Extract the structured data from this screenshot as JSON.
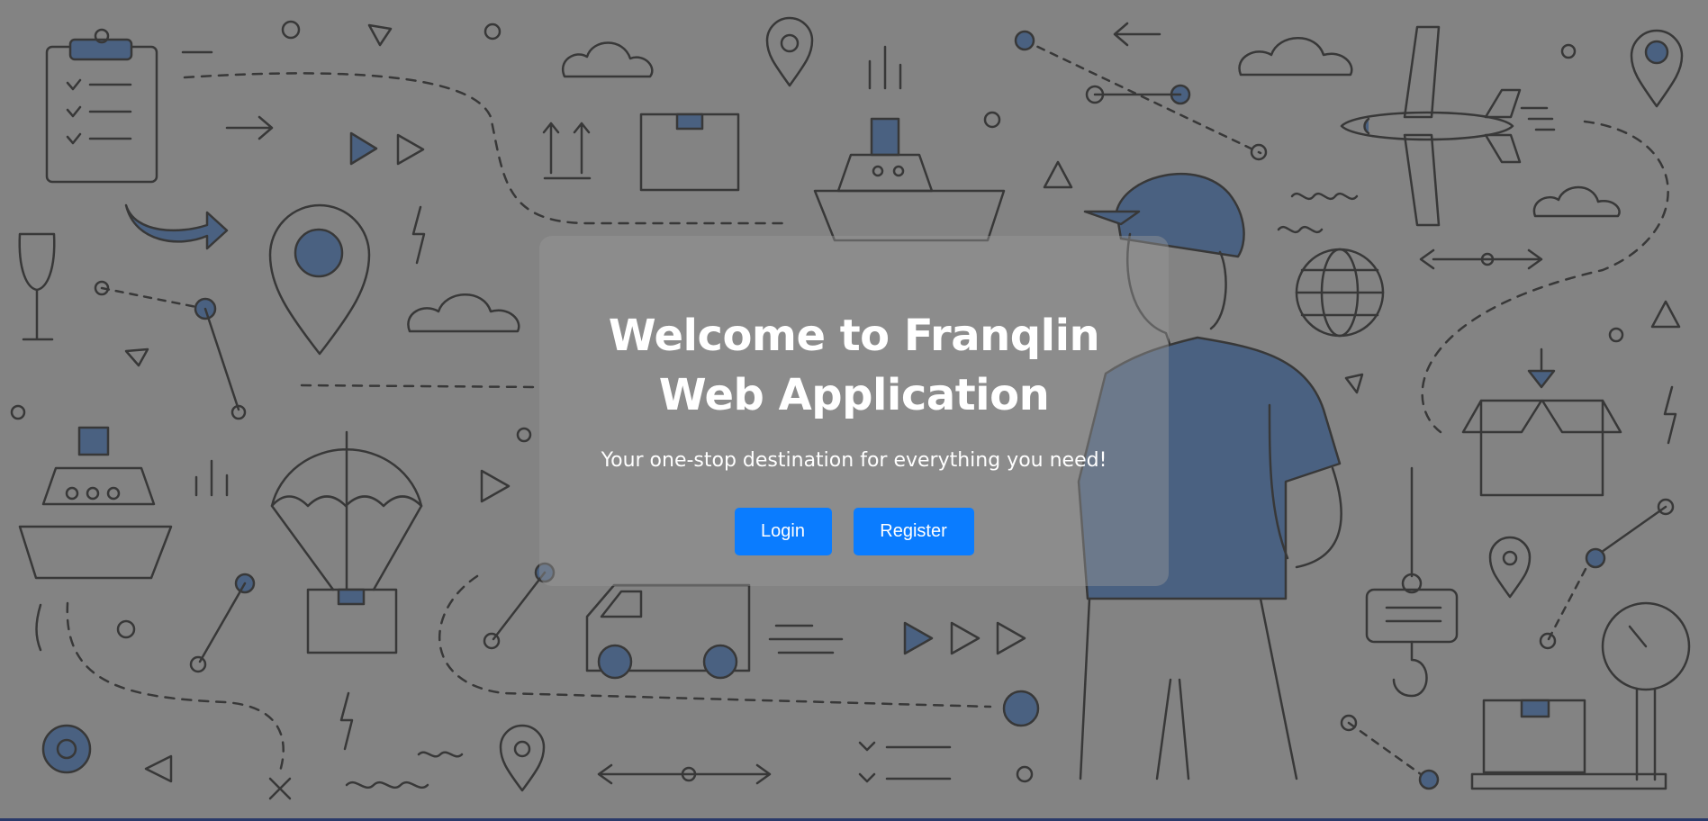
{
  "hero": {
    "title": "Welcome to Franqlin Web Application",
    "subtitle": "Your one-stop destination for everything you need!",
    "login_label": "Login",
    "register_label": "Register"
  },
  "colors": {
    "primary_button": "#0a7cff",
    "illustration_accent": "#5b8fd6",
    "overlay": "#3c3c3c"
  },
  "background_icons": [
    "clipboard-icon",
    "cloud-icon",
    "map-pin-icon",
    "package-box-icon",
    "ship-icon",
    "airplane-icon",
    "delivery-person-icon",
    "globe-icon",
    "parachute-package-icon",
    "delivery-truck-icon",
    "gear-icon",
    "scale-icon",
    "crane-hook-icon",
    "open-box-icon",
    "wine-glass-icon"
  ]
}
